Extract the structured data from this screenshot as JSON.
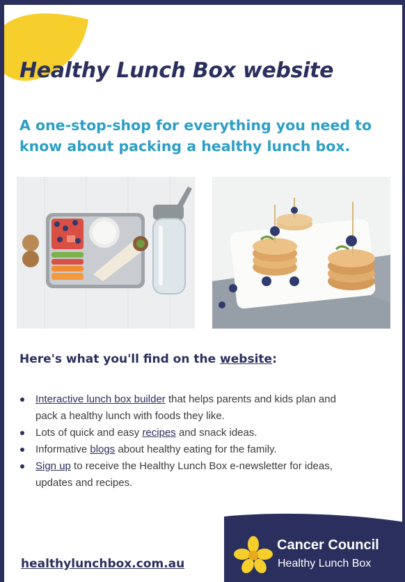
{
  "header": {
    "title": "Healthy Lunch Box website",
    "subtitle": "A one-stop-shop for everything you need to know about packing a healthy lunch box."
  },
  "images": {
    "left": "lunch-box-photo",
    "right": "mini-pancakes-photo"
  },
  "section": {
    "heading_prefix": "Here's what you'll find on the ",
    "heading_link": "website",
    "heading_suffix": ":"
  },
  "bullets": [
    {
      "link": "Interactive lunch box builder",
      "after": " that helps parents and kids plan and pack a healthy lunch with foods they like."
    },
    {
      "before": "Lots of quick and easy ",
      "link": "recipes",
      "after": " and snack ideas."
    },
    {
      "before": "Informative ",
      "link": "blogs",
      "after": " about healthy eating for the family."
    },
    {
      "link": "Sign up",
      "after": " to receive the Healthy Lunch Box e-newsletter for ideas, updates and recipes."
    }
  ],
  "footer": {
    "url": "healthylunchbox.com.au",
    "logo_name": "Cancer Council",
    "logo_sub": "Healthy Lunch Box"
  },
  "colors": {
    "navy": "#2b2f5e",
    "accent_blue": "#2c9fc6",
    "yellow": "#f6cf2c"
  }
}
